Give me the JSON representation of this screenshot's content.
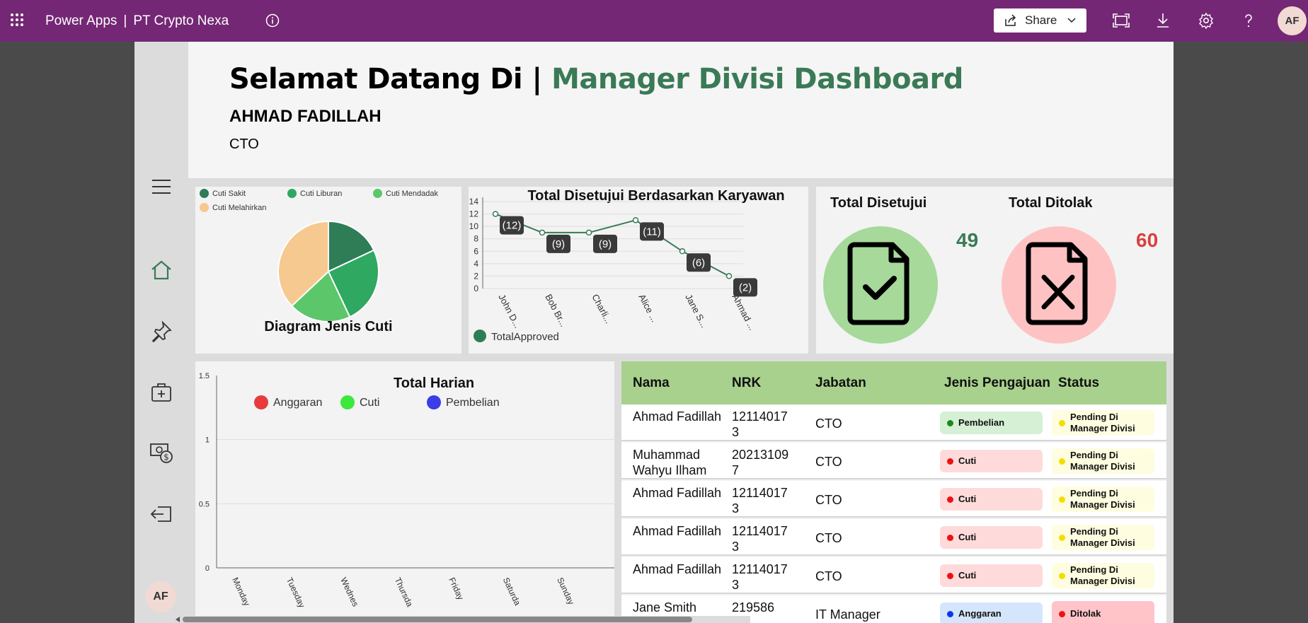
{
  "topbar": {
    "app_name": "Power Apps",
    "separator": "|",
    "company": "PT Crypto Nexa",
    "share_label": "Share",
    "avatar_initials": "AF"
  },
  "header": {
    "welcome_prefix": "Selamat Datang Di |",
    "welcome_highlight": "Manager Divisi Dashboard",
    "user_name": "AHMAD FADILLAH",
    "user_role": "CTO"
  },
  "sidebar": {
    "avatar_initials": "AF",
    "items": [
      "menu-icon",
      "home-icon",
      "pin-icon",
      "briefcase-add-icon",
      "money-icon",
      "logout-icon"
    ]
  },
  "colors": {
    "topbar": "#742774",
    "accent_green": "#3a7a56",
    "approved_circle": "#a6d99a",
    "rejected_circle": "#ffc2c2",
    "approved_value": "#3a7a56",
    "rejected_value": "#d94040"
  },
  "chart_data": [
    {
      "type": "pie",
      "title": "Diagram Jenis Cuti",
      "legend": [
        "Cuti Sakit",
        "Cuti Liburan",
        "Cuti Mendadak",
        "Cuti Melahirkan"
      ],
      "colors": [
        "#2e7d57",
        "#2fa862",
        "#5cc66b",
        "#f5c98f"
      ],
      "values": [
        18,
        25,
        20,
        37
      ],
      "legend_position": "top"
    },
    {
      "type": "line",
      "title": "Total Disetujui Berdasarkan Karyawan",
      "categories": [
        "John D...",
        "Bob Br...",
        "Charli...",
        "Alice ...",
        "Jane S...",
        "Ahmad ..."
      ],
      "series": [
        {
          "name": "TotalApproved",
          "values": [
            12,
            9,
            9,
            11,
            6,
            2
          ]
        }
      ],
      "data_labels": [
        "(12)",
        "(9)",
        "(9)",
        "(11)",
        "(6)",
        "(2)"
      ],
      "yticks": [
        "0",
        "2",
        "4",
        "6",
        "8",
        "10",
        "12",
        "14"
      ],
      "ylim": [
        0,
        14
      ],
      "grid": true,
      "legend_position": "bottom-left"
    },
    {
      "type": "bar",
      "title": "Total Harian",
      "categories": [
        "Monday",
        "Tuesday",
        "Wednesday",
        "Thursday",
        "Friday",
        "Saturday",
        "Sunday"
      ],
      "category_labels": [
        "Monday",
        "Tuesday",
        "Wednes",
        "Thursda",
        "Friday",
        "Saturda",
        "Sunday"
      ],
      "series": [
        {
          "name": "Anggaran",
          "color": "#e83c3c",
          "values": [
            0,
            0,
            0,
            0,
            0,
            0,
            0
          ]
        },
        {
          "name": "Cuti",
          "color": "#3ce83c",
          "values": [
            0,
            0,
            0,
            0,
            0,
            0,
            0
          ]
        },
        {
          "name": "Pembelian",
          "color": "#3c3ce8",
          "values": [
            0,
            0,
            0,
            0,
            0,
            0,
            0
          ]
        }
      ],
      "yticks": [
        "0",
        "0.5",
        "1",
        "1.5"
      ],
      "ylim": [
        0,
        1.5
      ],
      "grid": true,
      "legend_position": "top"
    }
  ],
  "totals": {
    "approved_label": "Total Disetujui",
    "approved_value": "49",
    "rejected_label": "Total Ditolak",
    "rejected_value": "60"
  },
  "table": {
    "headers": {
      "nama": "Nama",
      "nrk": "NRK",
      "jabatan": "Jabatan",
      "jenis": "Jenis Pengajuan",
      "status": "Status"
    },
    "rows": [
      {
        "nama": "Ahmad Fadillah",
        "nrk": "121140173",
        "jabatan": "CTO",
        "jenis": "Pembelian",
        "status": "Pending Di Manager Divisi"
      },
      {
        "nama": "Muhammad Wahyu Ilham",
        "nrk": "202131097",
        "jabatan": "CTO",
        "jenis": "Cuti",
        "status": "Pending Di Manager Divisi"
      },
      {
        "nama": "Ahmad Fadillah",
        "nrk": "121140173",
        "jabatan": "CTO",
        "jenis": "Cuti",
        "status": "Pending Di Manager Divisi"
      },
      {
        "nama": "Ahmad Fadillah",
        "nrk": "121140173",
        "jabatan": "CTO",
        "jenis": "Cuti",
        "status": "Pending Di Manager Divisi"
      },
      {
        "nama": "Ahmad Fadillah",
        "nrk": "121140173",
        "jabatan": "CTO",
        "jenis": "Cuti",
        "status": "Pending Di Manager Divisi"
      },
      {
        "nama": "Jane Smith",
        "nrk": "219586",
        "jabatan": "IT Manager",
        "jenis": "Anggaran",
        "status": "Ditolak"
      }
    ],
    "jenis_styles": {
      "Pembelian": {
        "bg": "#d5f0d5",
        "dot": "#1a8a1a"
      },
      "Cuti": {
        "bg": "#ffdada",
        "dot": "#ee1111"
      },
      "Anggaran": {
        "bg": "#d4e6fb",
        "dot": "#1133ee"
      }
    },
    "status_styles": {
      "Pending Di Manager Divisi": {
        "bg": "#fffde0",
        "dot": "#f0e000"
      },
      "Ditolak": {
        "bg": "#ffc4c8",
        "dot": "#ee1111"
      }
    }
  }
}
